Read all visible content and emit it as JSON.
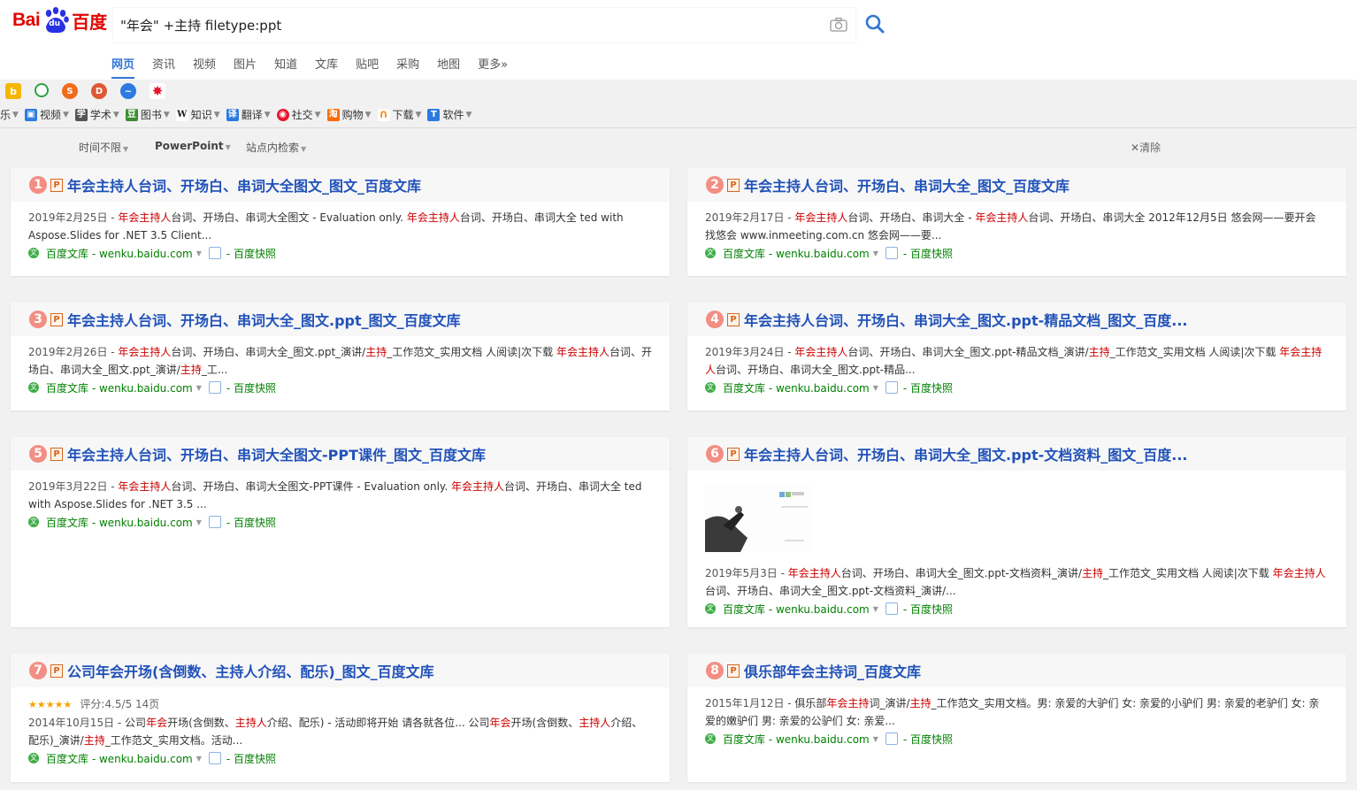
{
  "header": {
    "logo": {
      "bai": "Bai",
      "du": "du",
      "cn": "百度"
    },
    "search_query": "\"年会\" +主持 filetype:ppt",
    "tabs": [
      "网页",
      "资讯",
      "视频",
      "图片",
      "知道",
      "文库",
      "贴吧",
      "采购",
      "地图",
      "更多»"
    ]
  },
  "bookmarks": [
    {
      "label": "乐",
      "icon": "music-icon",
      "color": "#e04a3f"
    },
    {
      "label": "视频",
      "icon": "tv-icon",
      "color": "#2d7be0"
    },
    {
      "label": "学术",
      "icon": "scholar-icon",
      "color": "#333333"
    },
    {
      "label": "图书",
      "icon": "book-icon",
      "color": "#3a8d2f"
    },
    {
      "label": "知识",
      "icon": "wiki-icon",
      "color": "#333333"
    },
    {
      "label": "翻译",
      "icon": "translate-icon",
      "color": "#2d7be0"
    },
    {
      "label": "社交",
      "icon": "weibo-icon",
      "color": "#e6162d"
    },
    {
      "label": "购物",
      "icon": "shop-icon",
      "color": "#ff6a00"
    },
    {
      "label": "下载",
      "icon": "download-icon",
      "color": "#ff8c00"
    },
    {
      "label": "软件",
      "icon": "software-icon",
      "color": "#2d7be0"
    }
  ],
  "filters": {
    "time": "时间不限",
    "filetype": "PowerPoint",
    "site": "站点内检索",
    "clear": "清除"
  },
  "results": [
    {
      "num": "1",
      "title": "年会主持人台词、开场白、串词大全图文_图文_百度文库",
      "date": "2019年2月25日 - ",
      "snippet_parts": [
        [
          "年会主持人",
          true
        ],
        [
          "台词、开场白、串词大全图文 - Evaluation only. ",
          false
        ],
        [
          "年会主持人",
          true
        ],
        [
          "台词、开场白、串词大全 ted with Aspose.Slides for .NET 3.5 Client...",
          false
        ]
      ],
      "source": "百度文库 - wenku.baidu.com",
      "snapshot": "- 百度快照"
    },
    {
      "num": "2",
      "title": "年会主持人台词、开场白、串词大全_图文_百度文库",
      "date": "2019年2月17日 - ",
      "snippet_parts": [
        [
          "年会主持人",
          true
        ],
        [
          "台词、开场白、串词大全 - ",
          false
        ],
        [
          "年会主持人",
          true
        ],
        [
          "台词、开场白、串词大全 2012年12月5日 悠会网——要开会 找悠会 www.inmeeting.com.cn 悠会网——要...",
          false
        ]
      ],
      "source": "百度文库 - wenku.baidu.com",
      "snapshot": "- 百度快照"
    },
    {
      "num": "3",
      "title": "年会主持人台词、开场白、串词大全_图文.ppt_图文_百度文库",
      "date": "2019年2月26日 - ",
      "snippet_parts": [
        [
          "年会主持人",
          true
        ],
        [
          "台词、开场白、串词大全_图文.ppt_演讲/",
          false
        ],
        [
          "主持",
          true
        ],
        [
          "_工作范文_实用文档 人阅读|次下载 ",
          false
        ],
        [
          "年会主持人",
          true
        ],
        [
          "台词、开场白、串词大全_图文.ppt_演讲/",
          false
        ],
        [
          "主持",
          true
        ],
        [
          "_工...",
          false
        ]
      ],
      "source": "百度文库 - wenku.baidu.com",
      "snapshot": "- 百度快照"
    },
    {
      "num": "4",
      "title": "年会主持人台词、开场白、串词大全_图文.ppt-精品文档_图文_百度...",
      "date": "2019年3月24日 - ",
      "snippet_parts": [
        [
          "年会主持人",
          true
        ],
        [
          "台词、开场白、串词大全_图文.ppt-精品文档_演讲/",
          false
        ],
        [
          "主持",
          true
        ],
        [
          "_工作范文_实用文档 人阅读|次下载 ",
          false
        ],
        [
          "年会主持人",
          true
        ],
        [
          "台词、开场白、串词大全_图文.ppt-精品...",
          false
        ]
      ],
      "source": "百度文库 - wenku.baidu.com",
      "snapshot": "- 百度快照"
    },
    {
      "num": "5",
      "title": "年会主持人台词、开场白、串词大全图文-PPT课件_图文_百度文库",
      "date": "2019年3月22日 - ",
      "snippet_parts": [
        [
          "年会主持人",
          true
        ],
        [
          "台词、开场白、串词大全图文-PPT课件 - Evaluation only. ",
          false
        ],
        [
          "年会主持人",
          true
        ],
        [
          "台词、开场白、串词大全 ted with Aspose.Slides for .NET 3.5 ...",
          false
        ]
      ],
      "source": "百度文库 - wenku.baidu.com",
      "snapshot": "- 百度快照"
    },
    {
      "num": "6",
      "title": "年会主持人台词、开场白、串词大全_图文.ppt-文档资料_图文_百度...",
      "date": "2019年5月3日 - ",
      "snippet_parts": [
        [
          "年会主持人",
          true
        ],
        [
          "台词、开场白、串词大全_图文.ppt-文档资料_演讲/",
          false
        ],
        [
          "主持",
          true
        ],
        [
          "_工作范文_实用文档 人阅读|次下载 ",
          false
        ],
        [
          "年会主持人",
          true
        ],
        [
          "台词、开场白、串词大全_图文.ppt-文档资料_演讲/...",
          false
        ]
      ],
      "source": "百度文库 - wenku.baidu.com",
      "snapshot": "- 百度快照"
    },
    {
      "num": "7",
      "title": "公司年会开场(含倒数、主持人介绍、配乐)_图文_百度文库",
      "rating": "评分:4.5/5 14页",
      "date": "2014年10月15日 - ",
      "snippet_parts": [
        [
          "公司",
          false
        ],
        [
          "年会",
          true
        ],
        [
          "开场(含倒数、",
          false
        ],
        [
          "主持人",
          true
        ],
        [
          "介绍、配乐) - 活动即将开始 请各就各位... 公司",
          false
        ],
        [
          "年会",
          true
        ],
        [
          "开场(含倒数、",
          false
        ],
        [
          "主持人",
          true
        ],
        [
          "介绍、配乐)_演讲/",
          false
        ],
        [
          "主持",
          true
        ],
        [
          "_工作范文_实用文档。活动...",
          false
        ]
      ],
      "source": "百度文库 - wenku.baidu.com",
      "snapshot": "- 百度快照"
    },
    {
      "num": "8",
      "title": "俱乐部年会主持词_百度文库",
      "date": "2015年1月12日 - ",
      "snippet_parts": [
        [
          "俱乐部",
          false
        ],
        [
          "年会主持",
          true
        ],
        [
          "词_演讲/",
          false
        ],
        [
          "主持",
          true
        ],
        [
          "_工作范文_实用文档。男: 亲爱的大驴们 女: 亲爱的小驴们 男: 亲爱的老驴们 女: 亲爱的嫩驴们 男: 亲爱的公驴们 女: 亲爱...",
          false
        ]
      ],
      "source": "百度文库 - wenku.baidu.com",
      "snapshot": "- 百度快照"
    }
  ]
}
